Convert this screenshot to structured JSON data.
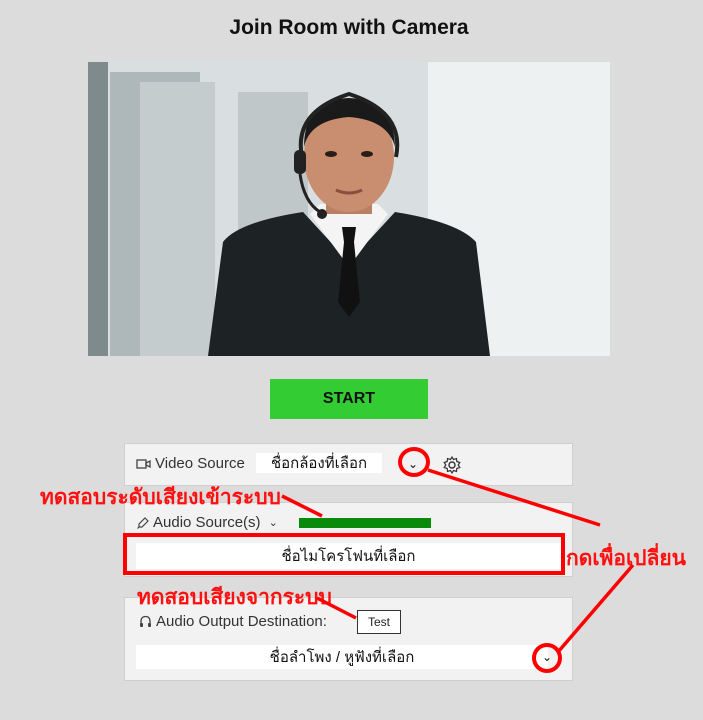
{
  "page": {
    "title": "Join Room with Camera",
    "start_label": "START"
  },
  "video": {
    "label": "Video Source",
    "selected": "ชื่อกล้องที่เลือก"
  },
  "audio_input": {
    "label": "Audio Source(s)",
    "selected": "ชื่อไมโครโฟนที่เลือก",
    "level_percent": 100
  },
  "audio_output": {
    "label": "Audio Output Destination:",
    "test_label": "Test",
    "selected": "ชื่อลำโพง / หูฟังที่เลือก"
  },
  "annotations": {
    "test_input_level": "ทดสอบระดับเสียงเข้าระบบ",
    "test_output_sound": "ทดสอบเสียงจากระบบ",
    "press_to_change": "กดเพื่อเปลี่ยน"
  },
  "colors": {
    "start_button": "#33cc33",
    "level_fill": "#0a8a0a",
    "annotation": "#ff0000"
  },
  "icons": {
    "video": "video-camera-icon",
    "audio_input": "microphone-icon",
    "audio_output": "headphones-icon",
    "settings": "gear-icon",
    "dropdown": "chevron-down-icon"
  }
}
